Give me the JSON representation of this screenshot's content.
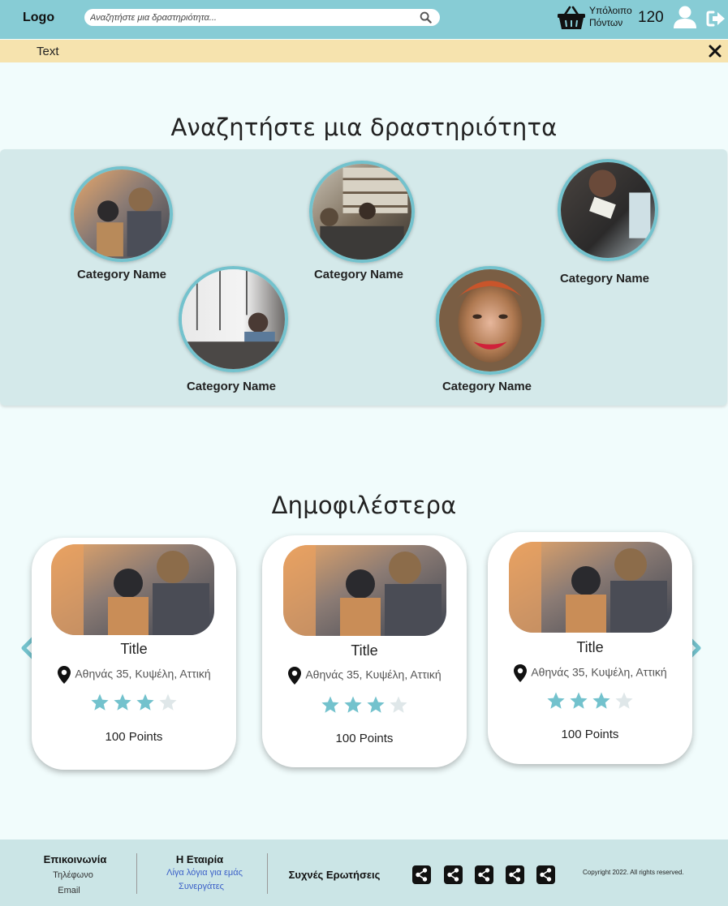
{
  "header": {
    "logo": "Logo",
    "search_placeholder": "Αναζητήστε μια δραστηριότητα...",
    "points_label_line1": "Υπόλοιπο",
    "points_label_line2": "Πόντων",
    "points_value": "120",
    "icons": [
      "basket-icon",
      "search-icon",
      "user-icon",
      "logout-icon"
    ]
  },
  "notice": {
    "text": "Text"
  },
  "categories_section": {
    "title": "Αναζητήστε μια δραστηριότητα",
    "items": [
      {
        "name": "Category Name"
      },
      {
        "name": "Category Name"
      },
      {
        "name": "Category Name"
      },
      {
        "name": "Category Name"
      },
      {
        "name": "Category Name"
      }
    ]
  },
  "popular_section": {
    "title": "Δημοφιλέστερα",
    "cards": [
      {
        "title": "Title",
        "address": "Αθηνάς 35, Κυψέλη, Αττική",
        "rating": 3,
        "rating_max": 4,
        "points": "100 Points"
      },
      {
        "title": "Title",
        "address": "Αθηνάς 35, Κυψέλη, Αττική",
        "rating": 3,
        "rating_max": 4,
        "points": "100 Points"
      },
      {
        "title": "Title",
        "address": "Αθηνάς 35, Κυψέλη, Αττική",
        "rating": 3,
        "rating_max": 4,
        "points": "100 Points"
      }
    ]
  },
  "footer": {
    "contact_heading": "Επικοινωνία",
    "contact_phone": "Τηλέφωνο",
    "contact_email": "Email",
    "company_heading": "Η Εταιρία",
    "company_about": "Λίγα λόγια για εμάς",
    "company_partners": "Συνεργάτες",
    "faq": "Συχνές Ερωτήσεις",
    "copyright": "Copyright 2022. All rights reserved."
  },
  "colors": {
    "header_bg": "#87ccd5",
    "accent": "#73c2cd",
    "notice_bg": "#f6e3ae",
    "page_bg": "#f1fcfc",
    "panel_bg": "#d4e9ea",
    "link": "#3a5fc8"
  }
}
